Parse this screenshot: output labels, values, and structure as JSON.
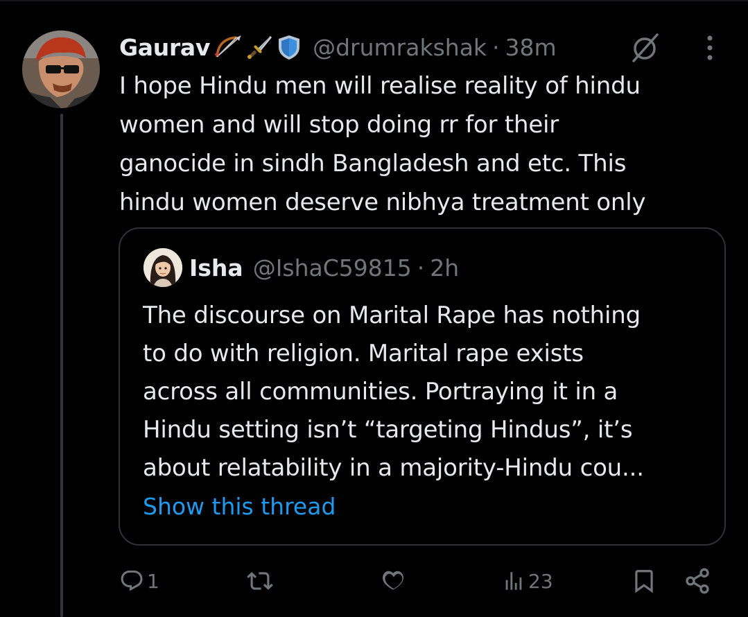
{
  "tweet": {
    "author_name": "Gaurav",
    "author_handle": "@drumrakshak",
    "separator": "·",
    "time": "38m",
    "text_lines": [
      "I hope Hindu men will realise reality of hindu",
      "women and will stop doing rr for their",
      "ganocide in sindh Bangladesh and etc. This",
      "hindu women deserve nibhya treatment only"
    ],
    "name_emojis": [
      "bow-and-arrow-icon",
      "dagger-icon",
      "shield-icon"
    ]
  },
  "quote": {
    "author_name": "Isha",
    "author_handle": "@IshaC59815",
    "separator": "·",
    "time": "2h",
    "text_lines": [
      "The discourse on Marital Rape has nothing",
      "to do with religion. Marital rape exists",
      "across all communities. Portraying it in a",
      "Hindu setting isn’t “targeting Hindus”, it’s",
      "about relatability in a majority-Hindu cou..."
    ],
    "show_thread": "Show this thread"
  },
  "actions": {
    "reply_count": "1",
    "repost_count": "",
    "like_count": "",
    "views_count": "23"
  },
  "colors": {
    "background": "#000000",
    "text_primary": "#e7e9ea",
    "text_secondary": "#71767b",
    "link": "#1d9bf0",
    "border": "#2f3336"
  }
}
